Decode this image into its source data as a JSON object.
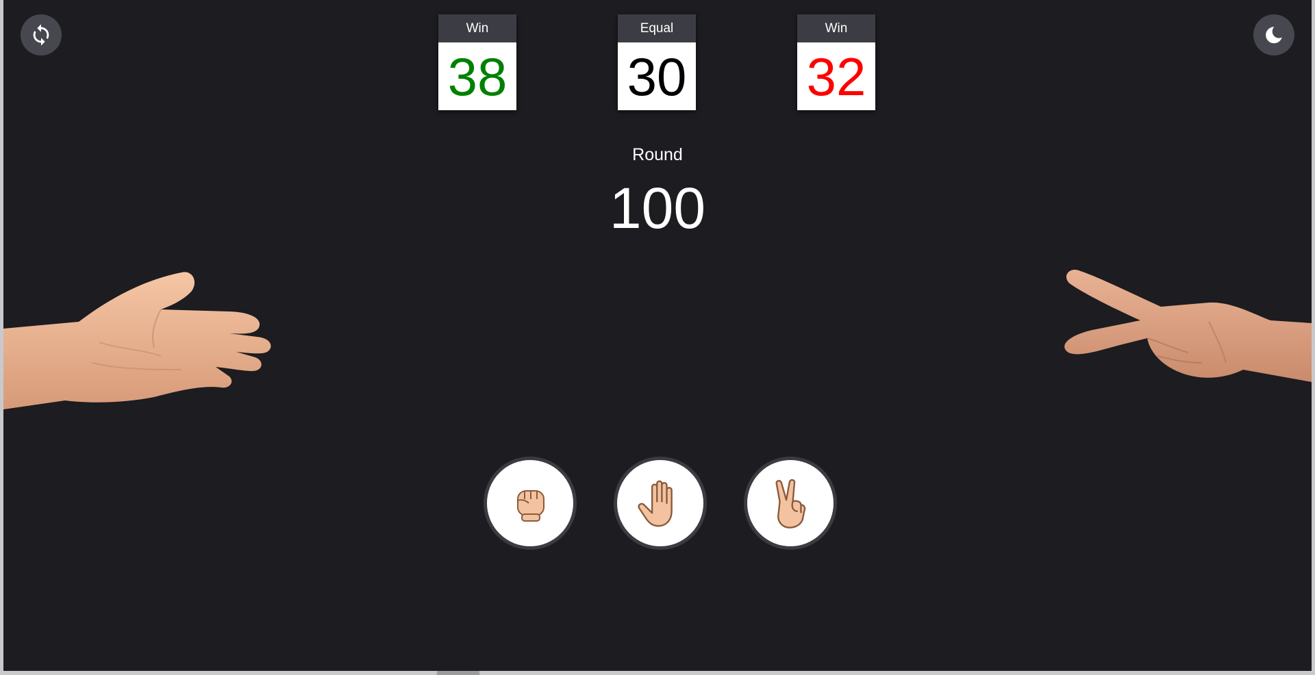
{
  "theme": {
    "background": "#1c1c21",
    "card_header": "#3c3c44",
    "button_bg": "#47474f",
    "win_left_color": "#008000",
    "equal_color": "#000000",
    "win_right_color": "#ff0000",
    "skin": "#efb99a"
  },
  "controls": {
    "restart_icon": "refresh-icon",
    "theme_icon": "moon-icon"
  },
  "scoreboard": {
    "player": {
      "label": "Win",
      "value": "38"
    },
    "draw": {
      "label": "Equal",
      "value": "30"
    },
    "computer": {
      "label": "Win",
      "value": "32"
    }
  },
  "round": {
    "label": "Round",
    "number": "100"
  },
  "hands": {
    "player_shape": "paper",
    "computer_shape": "scissors"
  },
  "choices": [
    {
      "name": "rock",
      "icon": "fist-icon"
    },
    {
      "name": "paper",
      "icon": "open-hand-icon"
    },
    {
      "name": "scissors",
      "icon": "victory-hand-icon"
    }
  ]
}
